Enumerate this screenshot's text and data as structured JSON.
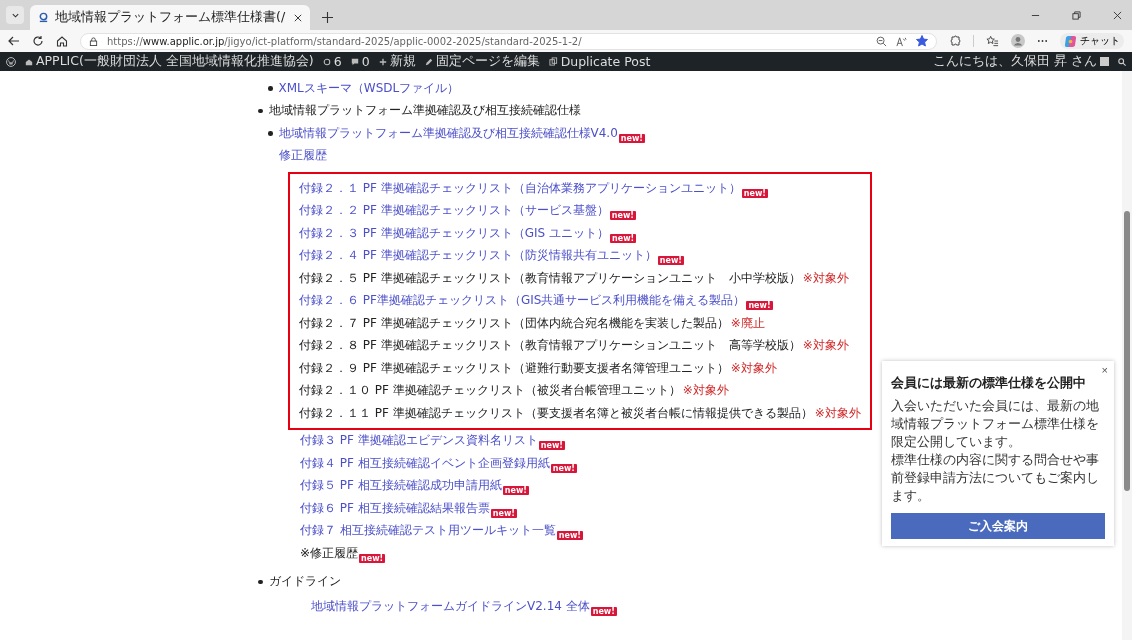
{
  "browser": {
    "tab": {
      "title": "地域情報プラットフォーム標準仕様書(/",
      "selected": true
    },
    "url": {
      "scheme": "https://",
      "host": "www.applic.or.jp",
      "path": "/jigyo/ict-platform/standard-2025/applic-0002-2025/standard-2025-1-2/"
    },
    "favorite": true,
    "copilot_label": "チャット"
  },
  "admin_bar": {
    "site": "APPLIC(一般財団法人 全国地域情報化推進協会)",
    "updates": "6",
    "comments": "0",
    "new": "新規",
    "edit": "固定ページを編集",
    "duplicate": "Duplicate Post",
    "greeting": "こんにちは、久保田 昇 さん"
  },
  "content": [
    {
      "kind": "sub",
      "text": "XMLスキーマ（WSDLファイル）",
      "link": true
    },
    {
      "kind": "top",
      "text": "地域情報プラットフォーム準拠確認及び相互接続確認仕様",
      "link": false
    },
    {
      "kind": "sub",
      "text": "地域情報プラットフォーム準拠確認及び相互接続確認仕様V4.0",
      "link": true,
      "badge": "new!"
    },
    {
      "kind": "indent",
      "text": "修正履歴",
      "link": true
    },
    {
      "kind": "box",
      "items": [
        {
          "text": "付録２．１ PF 準拠確認チェックリスト（自治体業務アプリケーションユニット）",
          "link": true,
          "badge": "new!"
        },
        {
          "text": "付録２．２ PF 準拠確認チェックリスト（サービス基盤）",
          "link": true,
          "badge": "new!"
        },
        {
          "text": "付録２．３ PF 準拠確認チェックリスト（GIS ユニット）",
          "link": true,
          "badge": "new!"
        },
        {
          "text": "付録２．４ PF 準拠確認チェックリスト（防災情報共有ユニット）",
          "link": true,
          "badge": "new!"
        },
        {
          "text": "付録２．５ PF 準拠確認チェックリスト（教育情報アプリケーションユニット　小中学校版）",
          "link": false,
          "note": "※対象外"
        },
        {
          "text": "付録２．６ PF準拠確認チェックリスト（GIS共通サービス利用機能を備える製品）",
          "link": true,
          "badge": "new!"
        },
        {
          "text": "付録２．７ PF 準拠確認チェックリスト（団体内統合宛名機能を実装した製品）",
          "link": false,
          "note": "※廃止"
        },
        {
          "text": "付録２．８ PF 準拠確認チェックリスト（教育情報アプリケーションユニット　高等学校版）",
          "link": false,
          "note": "※対象外"
        },
        {
          "text": "付録２．９ PF 準拠確認チェックリスト（避難行動要支援者名簿管理ユニット）",
          "link": false,
          "note": "※対象外"
        },
        {
          "text": "付録２．１０ PF 準拠確認チェックリスト（被災者台帳管理ユニット）",
          "link": false,
          "note": "※対象外"
        },
        {
          "text": "付録２．１１ PF 準拠確認チェックリスト（要支援者名簿と被災者台帳に情報提供できる製品）",
          "link": false,
          "note": "※対象外"
        }
      ]
    },
    {
      "kind": "item",
      "text": "付録３ PF 準拠確認エビデンス資料名リスト",
      "link": true,
      "badge": "new!"
    },
    {
      "kind": "item",
      "text": "付録４ PF 相互接続確認イベント企画登録用紙",
      "link": true,
      "badge": "new!"
    },
    {
      "kind": "item",
      "text": "付録５ PF 相互接続確認成功申請用紙",
      "link": true,
      "badge": "new!"
    },
    {
      "kind": "item",
      "text": "付録６ PF 相互接続確認結果報告票",
      "link": true,
      "badge": "new!"
    },
    {
      "kind": "item",
      "text": "付録７ 相互接続確認テスト用ツールキット一覧",
      "link": true,
      "badge": "new!"
    },
    {
      "kind": "item",
      "text": "※修正履歴",
      "link": false,
      "badge": "new!"
    },
    {
      "kind": "top",
      "text": "ガイドライン",
      "link": false
    },
    {
      "kind": "deep",
      "text": "地域情報プラットフォームガイドラインV2.14 全体",
      "link": true,
      "badge": "new!"
    }
  ],
  "popup": {
    "close": "×",
    "title": "会員には最新の標準仕様を公開中",
    "body": [
      "入会いただいた会員には、最新の地域情報プラットフォーム標準仕様を限定公開しています。",
      "標準仕様の内容に関する問合せや事前登録申請方法についてもご案内します。"
    ],
    "button": "ご入会案内"
  }
}
